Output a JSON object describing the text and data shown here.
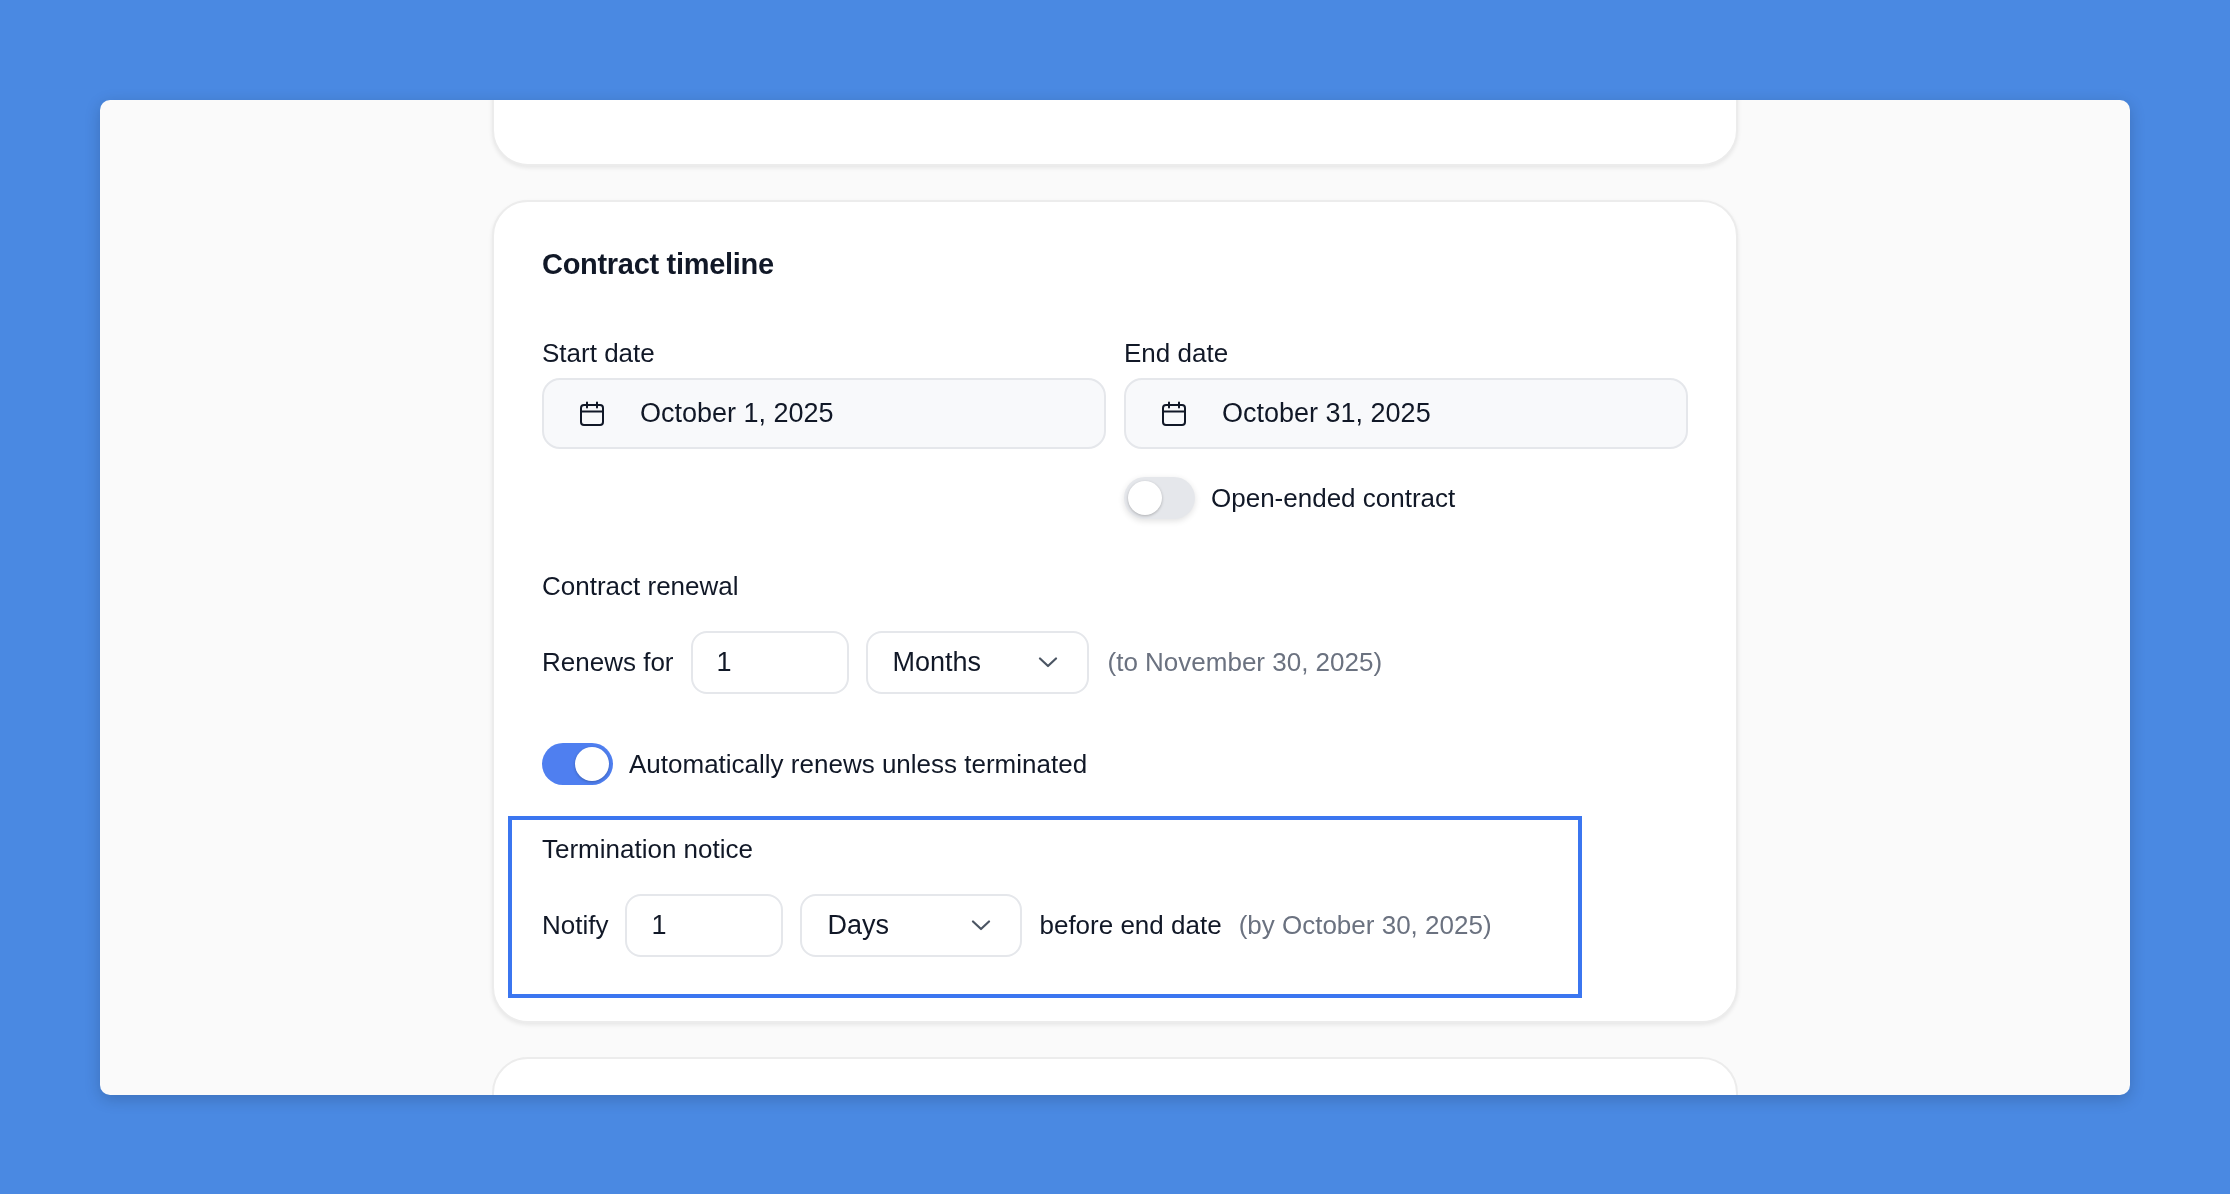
{
  "section": {
    "title": "Contract timeline",
    "dates": [
      {
        "label": "Start date",
        "value": "October 1, 2025"
      },
      {
        "label": "End date",
        "value": "October 31, 2025"
      }
    ],
    "open_ended_toggle": {
      "label": "Open-ended contract",
      "on": false
    },
    "renewal": {
      "title": "Contract renewal",
      "prefix": "Renews for",
      "amount": "1",
      "unit": "Months",
      "hint": "(to November 30, 2025)",
      "auto_renew": {
        "label": "Automatically renews unless terminated",
        "on": true
      }
    },
    "termination": {
      "title": "Termination notice",
      "highlighted": true,
      "prefix": "Notify",
      "amount": "1",
      "unit": "Days",
      "suffix": "before end date",
      "hint": "(by October 30, 2025)"
    }
  }
}
